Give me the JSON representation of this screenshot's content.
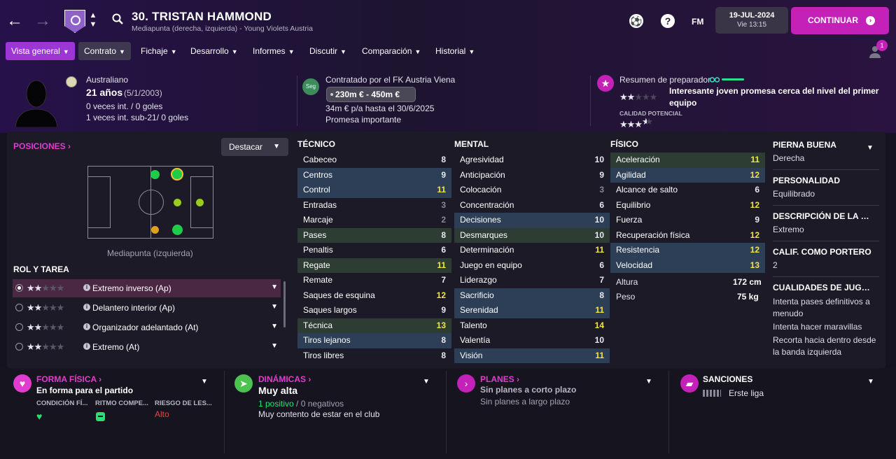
{
  "header": {
    "player_name": "30. TRISTAN HAMMOND",
    "player_subtitle": "Mediapunta (derecha, izquierda) - Young Violets Austria",
    "fm_label": "FM",
    "date": "19-JUL-2024",
    "day_time": "Vie 13:15",
    "continue_label": "CONTINUAR",
    "notification_count": "1"
  },
  "menu": [
    {
      "label": "Vista general"
    },
    {
      "label": "Contrato"
    },
    {
      "label": "Fichaje"
    },
    {
      "label": "Desarrollo"
    },
    {
      "label": "Informes"
    },
    {
      "label": "Discutir"
    },
    {
      "label": "Comparación"
    },
    {
      "label": "Historial"
    }
  ],
  "info": {
    "nationality": "Australiano",
    "age": "21 años",
    "birthdate": "(5/1/2003)",
    "caps": "0 veces int. / 0 goles",
    "u21_caps": "1 veces int. sub-21/ 0 goles",
    "contract_badge": "Seg",
    "contract_title": "Contratado por el FK Austria Viena",
    "value_range": "230m € - 450m €",
    "wage": "34m € p/a hasta el 30/6/2025",
    "status": "Promesa importante",
    "coach_title": "Resumen de preparador",
    "coach_summary": "Interesante joven promesa cerca del nivel del primer equipo",
    "potential_label": "CALIDAD POTENCIAL",
    "current_stars": 2,
    "potential_stars": 3.5
  },
  "positions": {
    "title": "POSICIONES",
    "highlight_label": "Destacar",
    "position_label": "Mediapunta (izquierda)"
  },
  "roles": {
    "title": "ROL Y TAREA",
    "items": [
      {
        "label": "Extremo inverso (Ap)",
        "stars": 2,
        "selected": true
      },
      {
        "label": "Delantero interior (Ap)",
        "stars": 2,
        "selected": false
      },
      {
        "label": "Organizador adelantado (At)",
        "stars": 2,
        "selected": false
      },
      {
        "label": "Extremo (At)",
        "stars": 2,
        "selected": false
      }
    ]
  },
  "attributes": {
    "technical_title": "TÉCNICO",
    "mental_title": "MENTAL",
    "physical_title": "FÍSICO",
    "technical": [
      {
        "name": "Cabeceo",
        "value": "8",
        "hl": ""
      },
      {
        "name": "Centros",
        "value": "9",
        "hl": "blue"
      },
      {
        "name": "Control",
        "value": "11",
        "hl": "blue"
      },
      {
        "name": "Entradas",
        "value": "3",
        "hl": ""
      },
      {
        "name": "Marcaje",
        "value": "2",
        "hl": ""
      },
      {
        "name": "Pases",
        "value": "8",
        "hl": "green"
      },
      {
        "name": "Penaltis",
        "value": "6",
        "hl": ""
      },
      {
        "name": "Regate",
        "value": "11",
        "hl": "green"
      },
      {
        "name": "Remate",
        "value": "7",
        "hl": ""
      },
      {
        "name": "Saques de esquina",
        "value": "12",
        "hl": ""
      },
      {
        "name": "Saques largos",
        "value": "9",
        "hl": ""
      },
      {
        "name": "Técnica",
        "value": "13",
        "hl": "green"
      },
      {
        "name": "Tiros lejanos",
        "value": "8",
        "hl": "blue"
      },
      {
        "name": "Tiros libres",
        "value": "8",
        "hl": ""
      }
    ],
    "mental": [
      {
        "name": "Agresividad",
        "value": "10",
        "hl": ""
      },
      {
        "name": "Anticipación",
        "value": "9",
        "hl": ""
      },
      {
        "name": "Colocación",
        "value": "3",
        "hl": ""
      },
      {
        "name": "Concentración",
        "value": "6",
        "hl": ""
      },
      {
        "name": "Decisiones",
        "value": "10",
        "hl": "blue"
      },
      {
        "name": "Desmarques",
        "value": "10",
        "hl": "green"
      },
      {
        "name": "Determinación",
        "value": "11",
        "hl": ""
      },
      {
        "name": "Juego en equipo",
        "value": "6",
        "hl": ""
      },
      {
        "name": "Liderazgo",
        "value": "7",
        "hl": ""
      },
      {
        "name": "Sacrificio",
        "value": "8",
        "hl": "blue"
      },
      {
        "name": "Serenidad",
        "value": "11",
        "hl": "blue"
      },
      {
        "name": "Talento",
        "value": "14",
        "hl": ""
      },
      {
        "name": "Valentía",
        "value": "10",
        "hl": ""
      },
      {
        "name": "Visión",
        "value": "11",
        "hl": "blue"
      }
    ],
    "physical": [
      {
        "name": "Aceleración",
        "value": "11",
        "hl": "green"
      },
      {
        "name": "Agilidad",
        "value": "12",
        "hl": "blue"
      },
      {
        "name": "Alcance de salto",
        "value": "6",
        "hl": ""
      },
      {
        "name": "Equilibrio",
        "value": "12",
        "hl": ""
      },
      {
        "name": "Fuerza",
        "value": "9",
        "hl": ""
      },
      {
        "name": "Recuperación física",
        "value": "12",
        "hl": ""
      },
      {
        "name": "Resistencia",
        "value": "12",
        "hl": "blue"
      },
      {
        "name": "Velocidad",
        "value": "13",
        "hl": "blue"
      }
    ],
    "height_label": "Altura",
    "height": "172 cm",
    "weight_label": "Peso",
    "weight": "75 kg"
  },
  "side": {
    "foot_title": "PIERNA BUENA",
    "foot": "Derecha",
    "personality_title": "PERSONALIDAD",
    "personality": "Equilibrado",
    "position_desc_title": "DESCRIPCIÓN DE LA P...",
    "position_desc": "Extremo",
    "gk_title": "CALIF. COMO PORTERO",
    "gk": "2",
    "traits_title": "CUALIDADES DE JUGA...",
    "traits": [
      "Intenta pases definitivos a menudo",
      "Intenta hacer maravillas",
      "Recorta hacia dentro desde la banda izquierda"
    ]
  },
  "bottom": {
    "fitness_title": "FORMA FÍSICA",
    "fitness_status": "En forma para el partido",
    "fitness_cols": [
      "CONDICIÓN FÍ...",
      "RITMO COMPE...",
      "RIESGO DE LES..."
    ],
    "injury_risk": "Alto",
    "dynamics_title": "DINÁMICAS",
    "dynamics_value": "Muy alta",
    "positives": "1 positivo",
    "slash": "/",
    "negatives": "0 negativos",
    "dynamics_note": "Muy contento de estar en el club",
    "plans_title": "PLANES",
    "plans_short": "Sin planes a corto plazo",
    "plans_long": "Sin planes a largo plazo",
    "sanctions_title": "SANCIONES",
    "sanctions_league": "Erste liga"
  },
  "colors": {
    "accent": "#c321b8",
    "menu_active": "#9c37d6",
    "attr_high": "#f2e63a",
    "attr_low": "#8a8898"
  }
}
